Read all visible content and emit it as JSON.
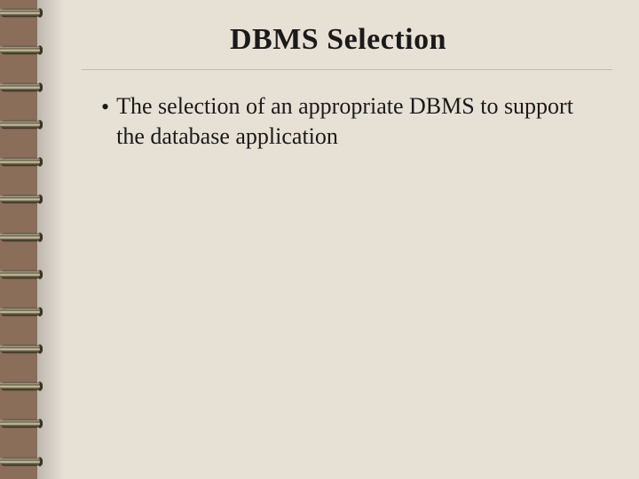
{
  "slide": {
    "title": "DBMS Selection",
    "bullets": [
      {
        "text": "The selection of an appropriate DBMS to support the database application"
      }
    ]
  }
}
